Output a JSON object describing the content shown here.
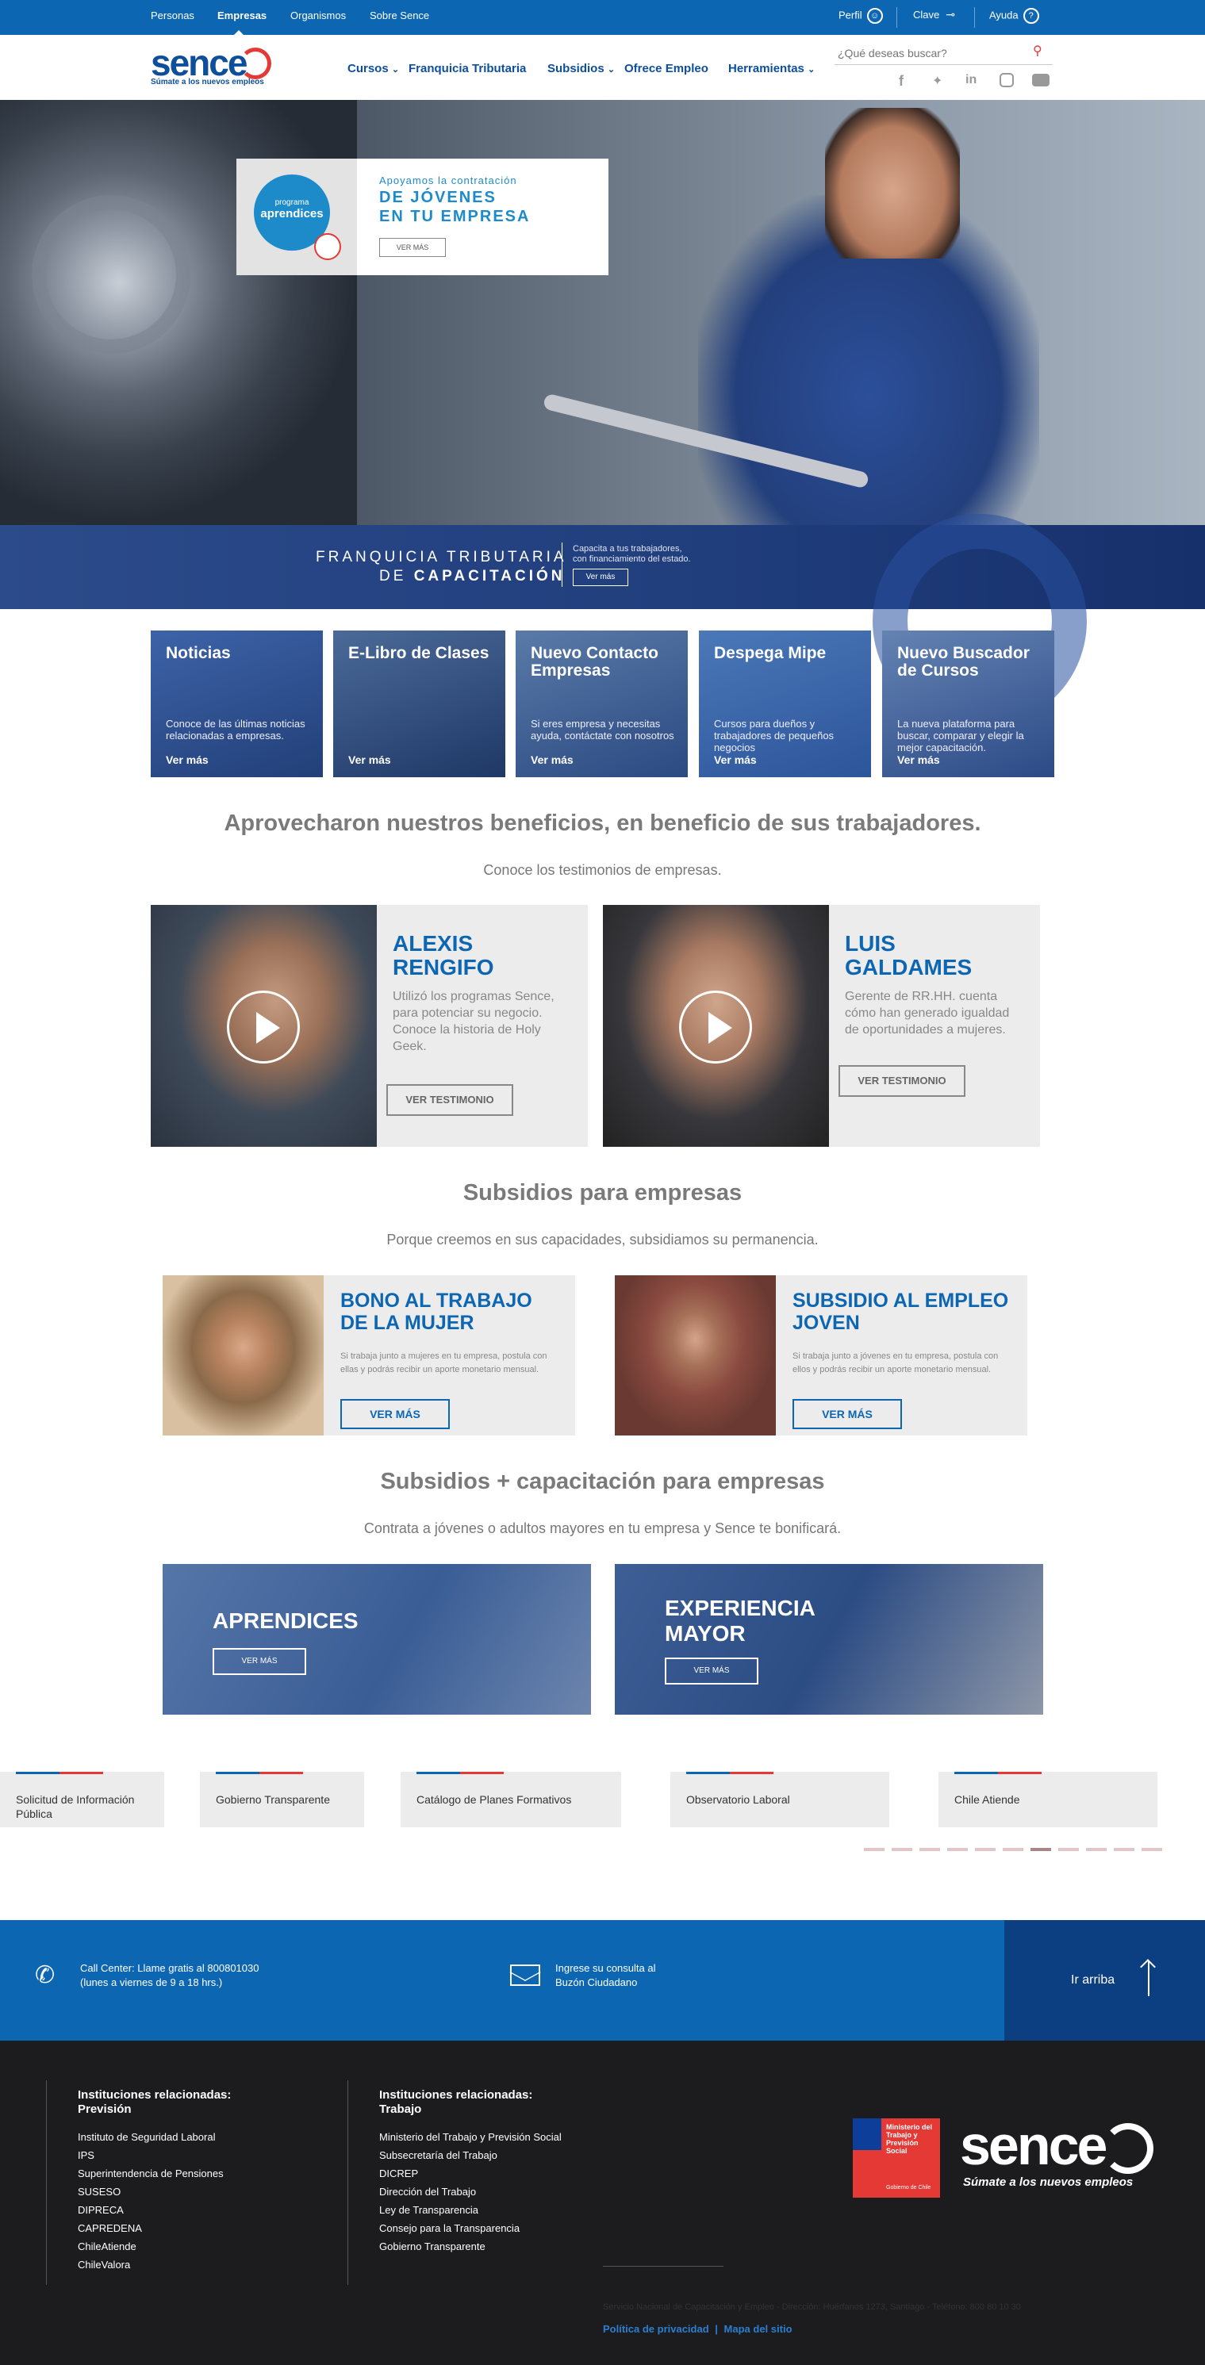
{
  "topbar": {
    "personas": "Personas",
    "empresas": "Empresas",
    "organismos": "Organismos",
    "sobre": "Sobre Sence",
    "perfil": "Perfil",
    "clave": "Clave",
    "ayuda": "Ayuda"
  },
  "header": {
    "logo_text": "sence",
    "logo_tagline": "Súmate a los nuevos empleos",
    "nav": {
      "cursos": "Cursos",
      "franquicia": "Franquicia Tributaria",
      "subsidios": "Subsidios",
      "ofrece": "Ofrece Empleo",
      "herramientas": "Herramientas"
    },
    "search_placeholder": "¿Qué deseas buscar?"
  },
  "hero": {
    "badge_line1": "programa",
    "badge_line2": "aprendices",
    "tagline": "Apoyamos la contratación",
    "headline1": "DE JÓVENES",
    "headline2": "EN TU EMPRESA",
    "button": "VER MÁS"
  },
  "franquicia_banner": {
    "line1": "FRANQUICIA TRIBUTARIA",
    "line2_prefix": "DE ",
    "line2_bold": "CAPACITACIÓN",
    "desc1": "Capacita a tus trabajadores,",
    "desc2": "con financiamiento del estado.",
    "button": "Ver más"
  },
  "tiles": [
    {
      "title": "Noticias",
      "desc": "Conoce de las últimas noticias relacionadas a empresas.",
      "link": "Ver más"
    },
    {
      "title": "E-Libro de Clases",
      "desc": "",
      "link": "Ver más"
    },
    {
      "title": "Nuevo Contacto Empresas",
      "desc": "Si eres empresa y necesitas ayuda, contáctate con nosotros",
      "link": "Ver más"
    },
    {
      "title": "Despega Mipe",
      "desc": "Cursos para dueños y trabajadores de pequeños negocios",
      "link": "Ver más"
    },
    {
      "title": "Nuevo Buscador de Cursos",
      "desc": "La nueva plataforma para buscar, comparar y elegir la mejor capacitación.",
      "link": "Ver más"
    }
  ],
  "testimonials_section": {
    "title": "Aprovecharon nuestros beneficios, en beneficio de sus trabajadores.",
    "subtitle": "Conoce los testimonios de empresas."
  },
  "testimonials": [
    {
      "name1": "ALEXIS",
      "name2": "RENGIFO",
      "desc": "Utilizó los programas Sence, para potenciar su negocio. Conoce la historia de Holy Geek.",
      "button": "VER TESTIMONIO"
    },
    {
      "name1": "LUIS",
      "name2": "GALDAMES",
      "desc": "Gerente de RR.HH. cuenta cómo han generado igualdad de oportunidades a mujeres.",
      "button": "VER TESTIMONIO"
    }
  ],
  "subsidios_section": {
    "title": "Subsidios para empresas",
    "subtitle": "Porque creemos en sus capacidades, subsidiamos su permanencia."
  },
  "subsidios": [
    {
      "title": "BONO AL TRABAJO DE LA MUJER",
      "desc": "Si trabaja junto a mujeres en tu empresa, postula con ellas y podrás recibir un aporte monetario mensual.",
      "button": "VER MÁS"
    },
    {
      "title": "SUBSIDIO AL EMPLEO JOVEN",
      "desc": "Si trabaja junto a jóvenes en tu empresa, postula con ellos y podrás recibir un aporte monetario mensual.",
      "button": "VER MÁS"
    }
  ],
  "capacitacion_section": {
    "title": "Subsidios + capacitación para empresas",
    "subtitle": "Contrata a jóvenes o adultos mayores en tu empresa y Sence te bonificará."
  },
  "capacitacion": [
    {
      "title1": "APRENDICES",
      "title2": "",
      "button": "VER MÁS"
    },
    {
      "title1": "EXPERIENCIA",
      "title2": "MAYOR",
      "button": "VER MÁS"
    }
  ],
  "link_cards": [
    "Solicitud de Información Pública",
    "Gobierno Transparente",
    "Catálogo de Planes Formativos",
    "Observatorio Laboral",
    "Chile Atiende"
  ],
  "carousel": {
    "pages": 11,
    "active": 7
  },
  "contact": {
    "phone1": "Call Center: Llame gratis al 800801030",
    "phone2": "(lunes a viernes de 9 a 18 hrs.)",
    "mail1": "Ingrese su consulta al",
    "mail2": "Buzón Ciudadano",
    "top": "Ir arriba"
  },
  "footer": {
    "col1_title1": "Instituciones relacionadas:",
    "col1_title2": "Previsión",
    "col1_items": [
      "Instituto de Seguridad Laboral",
      "IPS",
      "Superintendencia de Pensiones",
      "SUSESO",
      "DIPRECA",
      "CAPREDENA",
      "ChileAtiende",
      "ChileValora"
    ],
    "col2_title1": "Instituciones relacionadas:",
    "col2_title2": "Trabajo",
    "col2_items": [
      "Ministerio del Trabajo y Previsión Social",
      "Subsecretaría del Trabajo",
      "DICREP",
      "Dirección del Trabajo",
      "Ley de Transparencia",
      "Consejo para la Transparencia",
      "Gobierno Transparente"
    ],
    "ministry1": "Ministerio del",
    "ministry2": "Trabajo y",
    "ministry3": "Previsión",
    "ministry4": "Social",
    "ministry_gov": "Gobierno de Chile",
    "logo_text": "sence",
    "logo_tagline": "Súmate a los nuevos empleos",
    "address": "Servicio Nacional de Capacitación y Empleo - Dirección: Huérfanos 1273, Santiago - Teléfono: 800 80 10 30",
    "privacy": "Política de privacidad",
    "sep": "|",
    "sitemap": "Mapa del sitio"
  },
  "colors": {
    "brand_blue": "#0d66b2",
    "brand_red": "#e53935",
    "dark_blue": "#0c3f82",
    "footer_bg": "#1c1c1f"
  }
}
